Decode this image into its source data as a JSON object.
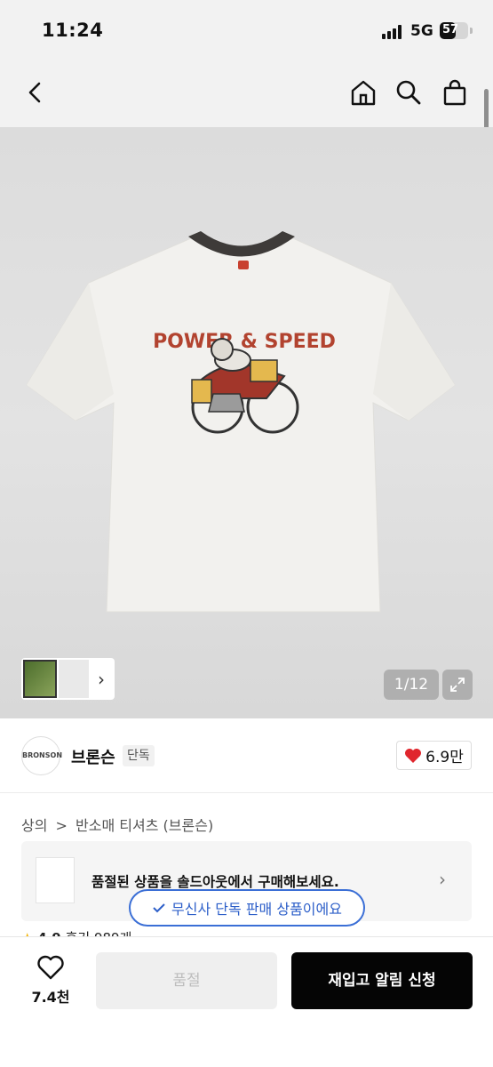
{
  "status_bar": {
    "time": "11:24",
    "network": "5G",
    "battery": "57",
    "battery_level": 0.57
  },
  "nav": {
    "icons": [
      "back-icon",
      "home-icon",
      "search-icon",
      "shopping-bag-icon"
    ]
  },
  "product_image": {
    "counter": "1/12",
    "print_text": "POWER & SPEED"
  },
  "brand": {
    "name": "브론슨",
    "tag": "단독",
    "likes": "6.9만"
  },
  "breadcrumb": {
    "items": [
      "상의",
      ">",
      "반소매 티셔츠 (브론슨)"
    ]
  },
  "soldout_card": {
    "text": "품절된 상품을 솔드아웃에서 구매해보세요."
  },
  "exclusive_badge": {
    "text": "무신사 단독 판매 상품이에요"
  },
  "rating": {
    "score": "4.9",
    "reviews": "후기 989개"
  },
  "bottom_bar": {
    "wish_count": "7.4천",
    "soldout_label": "품절",
    "restock_label": "재입고 알림 신청"
  },
  "colors": {
    "accent_blue": "#3b6fd6",
    "heart_red": "#e0262d",
    "primary_black": "#050505"
  }
}
